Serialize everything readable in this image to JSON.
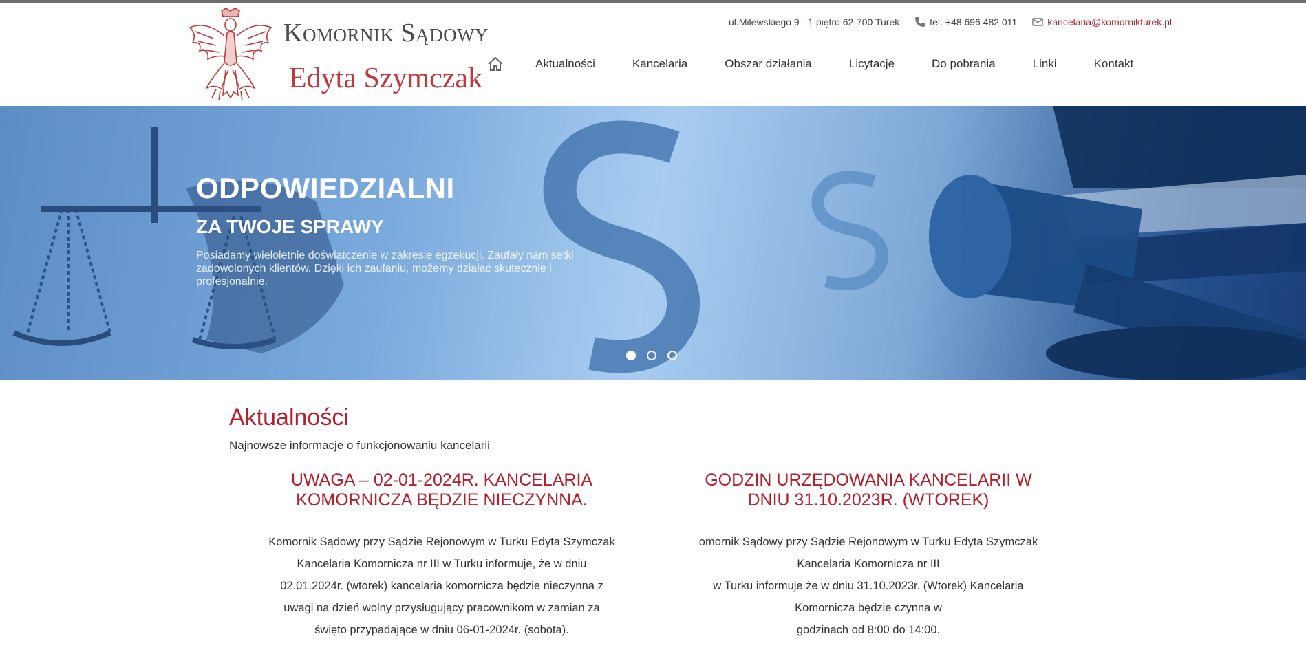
{
  "header": {
    "logo_line1": "Komornik Sądowy",
    "logo_line2": "Edyta Szymczak",
    "address": "ul.Milewskiego 9 - 1 piętro 62-700 Turek",
    "phone": "tel. +48 696 482 011",
    "email": "kancelaria@komornikturek.pl"
  },
  "nav": {
    "items": [
      "Aktualności",
      "Kancelaria",
      "Obszar działania",
      "Licytacje",
      "Do pobrania",
      "Linki",
      "Kontakt"
    ]
  },
  "hero": {
    "headline": "ODPOWIEDZIALNI",
    "subheadline": "ZA TWOJE SPRAWY",
    "description": "Posiadamy wieloletnie doświatczenie w zakresie egzekucji. Zaufały nam setki zadowolonych klientów. Dzięki ich zaufaniu, możemy działać skutecznie i profesjonalnie.",
    "slides_count": 3,
    "active_slide": 1
  },
  "news": {
    "title": "Aktualności",
    "subtitle": "Najnowsze informacje o funkcjonowaniu kancelarii",
    "posts": [
      {
        "title_line1": "UWAGA – 02-01-2024R. KANCELARIA",
        "title_line2": "KOMORNICZA BĘDZIE NIECZYNNA.",
        "lines": [
          "Komornik Sądowy przy Sądzie Rejonowym w Turku Edyta Szymczak",
          "Kancelaria Komornicza nr III w Turku informuje, że w dniu",
          "02.01.2024r. (wtorek) kancelaria komornicza będzie nieczynna z",
          "uwagi na dzień wolny przysługujący pracownikom w zamian za",
          "święto przypadające w dniu 06-01-2024r. (sobota)."
        ]
      },
      {
        "title_line1": "GODZIN URZĘDOWANIA KANCELARII W",
        "title_line2": "DNIU 31.10.2023R. (WTOREK)",
        "lines": [
          "omornik Sądowy przy Sądzie Rejonowym w Turku Edyta Szymczak",
          "Kancelaria Komornicza nr III",
          "w Turku informuje że w dniu 31.10.2023r. (Wtorek) Kancelaria",
          "Komornicza będzie czynna w",
          "godzinach od 8:00 do 14:00."
        ]
      }
    ]
  },
  "colors": {
    "accent_red": "#b41f2b",
    "hero_blue": "#244f8c"
  }
}
